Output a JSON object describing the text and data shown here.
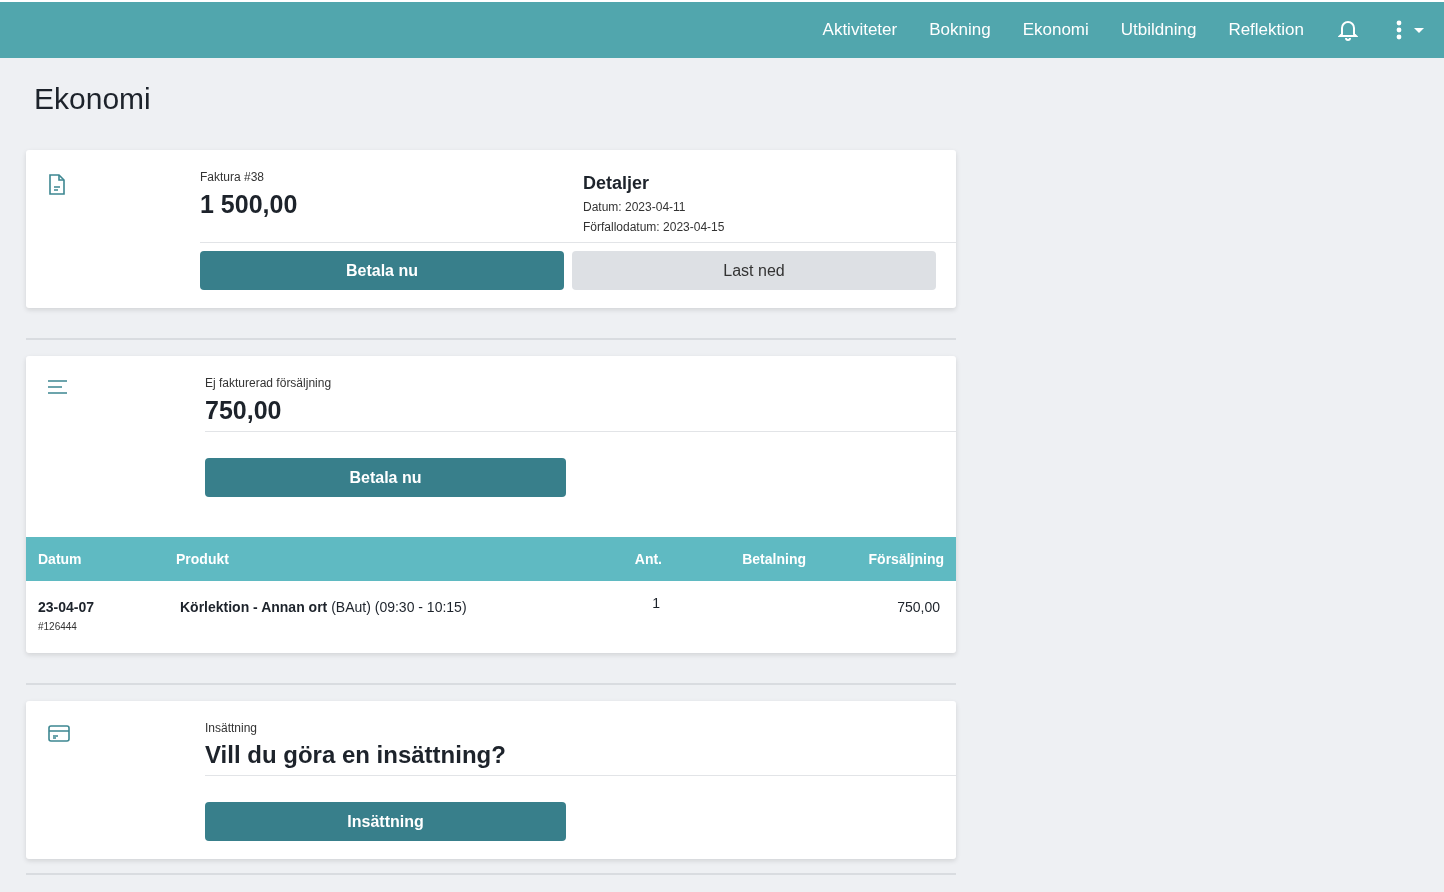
{
  "nav": {
    "items": [
      "Aktiviteter",
      "Bokning",
      "Ekonomi",
      "Utbildning",
      "Reflektion"
    ]
  },
  "page_title": "Ekonomi",
  "cards": [
    {
      "kind": "invoice",
      "label": "Faktura #38",
      "amount": "1 500,00",
      "details": {
        "title": "Detaljer",
        "lines": [
          "Datum: 2023-04-11",
          "Förfallodatum: 2023-04-15"
        ]
      },
      "buttons": [
        {
          "label": "Betala nu",
          "kind": "primary"
        },
        {
          "label": "Last ned",
          "kind": "secondary"
        }
      ]
    },
    {
      "kind": "sales",
      "label": "Ej fakturerad försäljning",
      "amount": "750,00",
      "buttons": [
        {
          "label": "Betala nu",
          "kind": "primary"
        }
      ],
      "table": {
        "columns": [
          "Datum",
          "Produkt",
          "Ant.",
          "Betalning",
          "Försäljning"
        ],
        "rows": [
          {
            "date": "23-04-07",
            "ref": "#126444",
            "product": "**Körlektion - Annan ort** (BAut) (09:30 - 10:15)",
            "quantity": "1",
            "sale": "750,00"
          }
        ]
      }
    },
    {
      "kind": "deposit",
      "label": "Insättning",
      "amount": "Vill du göra en insättning?",
      "buttons": [
        {
          "label": "Insättning",
          "kind": "primary"
        }
      ]
    }
  ]
}
